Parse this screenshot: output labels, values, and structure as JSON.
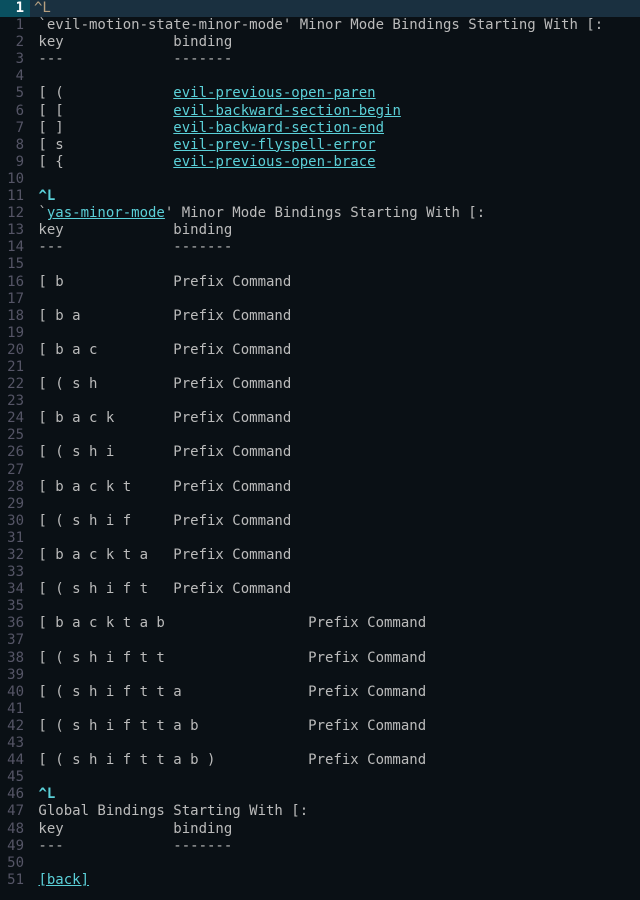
{
  "top": {
    "num": "1",
    "cursor": "^L"
  },
  "lines": [
    {
      "n": "1",
      "type": "text",
      "t": " `evil-motion-state-minor-mode' Minor Mode Bindings Starting With [:"
    },
    {
      "n": "2",
      "type": "text",
      "t": " key             binding"
    },
    {
      "n": "3",
      "type": "text",
      "t": " ---             -------"
    },
    {
      "n": "4",
      "type": "text",
      "t": ""
    },
    {
      "n": "5",
      "type": "link",
      "pre": " [ (             ",
      "link": "evil-previous-open-paren"
    },
    {
      "n": "6",
      "type": "link",
      "pre": " [ [             ",
      "link": "evil-backward-section-begin"
    },
    {
      "n": "7",
      "type": "link",
      "pre": " [ ]             ",
      "link": "evil-backward-section-end"
    },
    {
      "n": "8",
      "type": "link",
      "pre": " [ s             ",
      "link": "evil-prev-flyspell-error"
    },
    {
      "n": "9",
      "type": "link",
      "pre": " [ {             ",
      "link": "evil-previous-open-brace"
    },
    {
      "n": "10",
      "type": "text",
      "t": ""
    },
    {
      "n": "11",
      "type": "ctrl",
      "t": " ^L"
    },
    {
      "n": "12",
      "type": "link2",
      "pre": " `",
      "link": "yas-minor-mode",
      "post": "' Minor Mode Bindings Starting With [:"
    },
    {
      "n": "13",
      "type": "text",
      "t": " key             binding"
    },
    {
      "n": "14",
      "type": "text",
      "t": " ---             -------"
    },
    {
      "n": "15",
      "type": "text",
      "t": ""
    },
    {
      "n": "16",
      "type": "text",
      "t": " [ b             Prefix Command"
    },
    {
      "n": "17",
      "type": "text",
      "t": ""
    },
    {
      "n": "18",
      "type": "text",
      "t": " [ b a           Prefix Command"
    },
    {
      "n": "19",
      "type": "text",
      "t": ""
    },
    {
      "n": "20",
      "type": "text",
      "t": " [ b a c         Prefix Command"
    },
    {
      "n": "21",
      "type": "text",
      "t": ""
    },
    {
      "n": "22",
      "type": "text",
      "t": " [ ( s h         Prefix Command"
    },
    {
      "n": "23",
      "type": "text",
      "t": ""
    },
    {
      "n": "24",
      "type": "text",
      "t": " [ b a c k       Prefix Command"
    },
    {
      "n": "25",
      "type": "text",
      "t": ""
    },
    {
      "n": "26",
      "type": "text",
      "t": " [ ( s h i       Prefix Command"
    },
    {
      "n": "27",
      "type": "text",
      "t": ""
    },
    {
      "n": "28",
      "type": "text",
      "t": " [ b a c k t     Prefix Command"
    },
    {
      "n": "29",
      "type": "text",
      "t": ""
    },
    {
      "n": "30",
      "type": "text",
      "t": " [ ( s h i f     Prefix Command"
    },
    {
      "n": "31",
      "type": "text",
      "t": ""
    },
    {
      "n": "32",
      "type": "text",
      "t": " [ b a c k t a   Prefix Command"
    },
    {
      "n": "33",
      "type": "text",
      "t": ""
    },
    {
      "n": "34",
      "type": "text",
      "t": " [ ( s h i f t   Prefix Command"
    },
    {
      "n": "35",
      "type": "text",
      "t": ""
    },
    {
      "n": "36",
      "type": "text",
      "t": " [ b a c k t a b                 Prefix Command"
    },
    {
      "n": "37",
      "type": "text",
      "t": ""
    },
    {
      "n": "38",
      "type": "text",
      "t": " [ ( s h i f t t                 Prefix Command"
    },
    {
      "n": "39",
      "type": "text",
      "t": ""
    },
    {
      "n": "40",
      "type": "text",
      "t": " [ ( s h i f t t a               Prefix Command"
    },
    {
      "n": "41",
      "type": "text",
      "t": ""
    },
    {
      "n": "42",
      "type": "text",
      "t": " [ ( s h i f t t a b             Prefix Command"
    },
    {
      "n": "43",
      "type": "text",
      "t": ""
    },
    {
      "n": "44",
      "type": "text",
      "t": " [ ( s h i f t t a b )           Prefix Command"
    },
    {
      "n": "45",
      "type": "text",
      "t": ""
    },
    {
      "n": "46",
      "type": "ctrl",
      "t": " ^L"
    },
    {
      "n": "47",
      "type": "text",
      "t": " Global Bindings Starting With [:"
    },
    {
      "n": "48",
      "type": "text",
      "t": " key             binding"
    },
    {
      "n": "49",
      "type": "text",
      "t": " ---             -------"
    },
    {
      "n": "50",
      "type": "text",
      "t": ""
    },
    {
      "n": "51",
      "type": "back",
      "pre": " ",
      "link": "[back]"
    }
  ]
}
